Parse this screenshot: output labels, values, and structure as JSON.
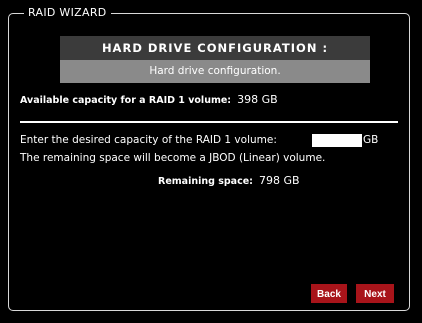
{
  "wizard": {
    "legend": "RAID WIZARD"
  },
  "header": {
    "title": "HARD DRIVE CONFIGURATION :",
    "subtitle": "Hard drive configuration."
  },
  "available": {
    "label": "Available capacity for a RAID 1 volume:",
    "value": "398 GB"
  },
  "capacity": {
    "prompt": "Enter the desired capacity of the RAID 1 volume:",
    "input_value": "",
    "unit": "GB",
    "note": "The remaining space will become a JBOD (Linear) volume."
  },
  "remaining": {
    "label": "Remaining space:",
    "value": "798 GB"
  },
  "buttons": {
    "back": "Back",
    "next": "Next"
  },
  "colors": {
    "background": "#000000",
    "header_bar": "#3b3b3b",
    "sub_bar": "#8a8a8a",
    "button": "#a8141a"
  }
}
